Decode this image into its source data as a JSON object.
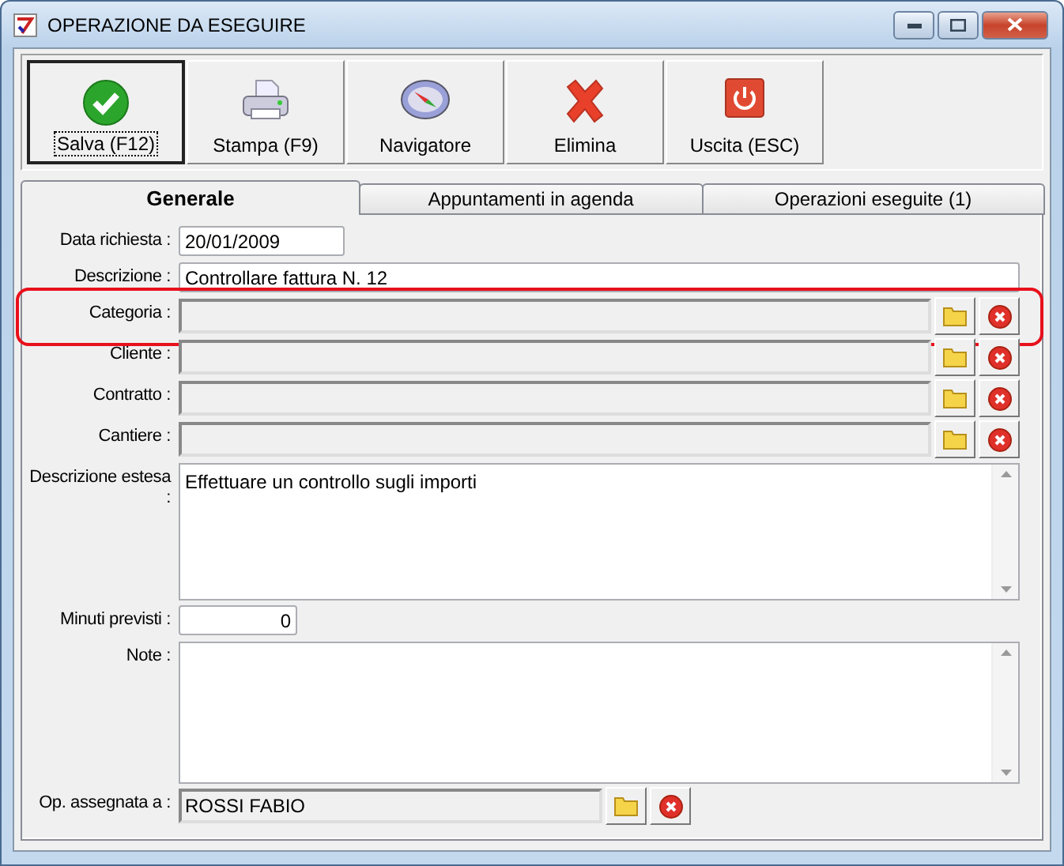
{
  "window": {
    "title": "OPERAZIONE DA ESEGUIRE"
  },
  "toolbar": [
    {
      "label": "Salva (F12)",
      "kind": "save",
      "focused": true
    },
    {
      "label": "Stampa (F9)",
      "kind": "print",
      "focused": false
    },
    {
      "label": "Navigatore",
      "kind": "compass",
      "focused": false
    },
    {
      "label": "Elimina",
      "kind": "delete",
      "focused": false
    },
    {
      "label": "Uscita (ESC)",
      "kind": "exit",
      "focused": false
    }
  ],
  "tabs": [
    {
      "label": "Generale",
      "selected": true
    },
    {
      "label": "Appuntamenti in agenda",
      "selected": false
    },
    {
      "label": "Operazioni eseguite (1)",
      "selected": false
    }
  ],
  "fields": [
    {
      "kind": "date",
      "label": "Data richiesta :",
      "value": "20/01/2009"
    },
    {
      "kind": "text",
      "label": "Descrizione :",
      "value": "Controllare fattura N. 12"
    },
    {
      "kind": "lookup",
      "label": "Categoria :",
      "highlighted": true
    },
    {
      "kind": "lookup",
      "label": "Cliente :",
      "highlighted": false
    },
    {
      "kind": "lookup",
      "label": "Contratto :",
      "highlighted": false
    },
    {
      "kind": "lookup",
      "label": "Cantiere :",
      "highlighted": false
    },
    {
      "kind": "memo",
      "label": "Descrizione estesa :",
      "value": "Effettuare un controllo sugli importi"
    },
    {
      "kind": "number",
      "label": "Minuti previsti :",
      "value": "0"
    },
    {
      "kind": "memo",
      "label": "Note :"
    },
    {
      "kind": "lookup_short",
      "label": "Op. assegnata a :",
      "value": "ROSSI FABIO",
      "highlighted": false
    }
  ]
}
